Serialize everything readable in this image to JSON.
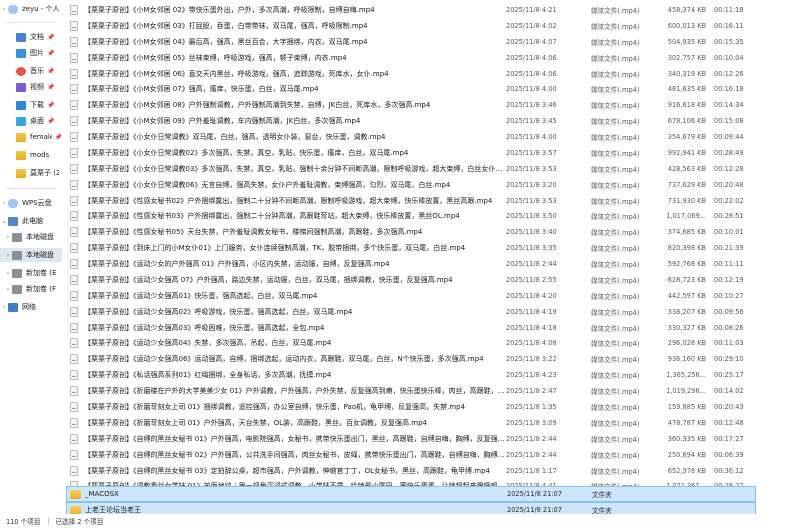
{
  "sidebar": {
    "items": [
      {
        "label": "zeyu - 个人",
        "icon": "cloud-icon",
        "chevron": "›",
        "pin": ""
      },
      {
        "label": "文档",
        "icon": "document-icon",
        "chevron": "",
        "pin": "📌"
      },
      {
        "label": "图片",
        "icon": "picture-icon",
        "chevron": "",
        "pin": "📌"
      },
      {
        "label": "音乐",
        "icon": "music-icon",
        "chevron": "",
        "pin": "📌"
      },
      {
        "label": "视频",
        "icon": "video-icon",
        "chevron": "",
        "pin": "📌"
      },
      {
        "label": "下载",
        "icon": "download-icon",
        "chevron": "",
        "pin": "📌"
      },
      {
        "label": "桌面",
        "icon": "desktop-icon",
        "chevron": "",
        "pin": "📌"
      },
      {
        "label": "female",
        "icon": "folder-icon",
        "chevron": "",
        "pin": "📌"
      },
      {
        "label": "mods",
        "icon": "folder-icon",
        "chevron": "",
        "pin": ""
      },
      {
        "label": "莫栗子 (20",
        "icon": "folder-icon",
        "chevron": "",
        "pin": ""
      },
      {
        "label": "WPS云盘",
        "icon": "cloud-drive-icon",
        "chevron": "›",
        "pin": ""
      },
      {
        "label": "此电脑",
        "icon": "computer-icon",
        "chevron": "⌄",
        "pin": ""
      },
      {
        "label": "本地磁盘",
        "icon": "drive-icon",
        "chevron": "›",
        "pin": ""
      },
      {
        "label": "本地磁盘",
        "icon": "drive-icon",
        "chevron": "›",
        "pin": ""
      },
      {
        "label": "新加卷 (E",
        "icon": "drive-icon",
        "chevron": "›",
        "pin": ""
      },
      {
        "label": "新加卷 (F",
        "icon": "drive-icon",
        "chevron": "›",
        "pin": ""
      },
      {
        "label": "网络",
        "icon": "network-icon",
        "chevron": "›",
        "pin": ""
      }
    ]
  },
  "files": [
    {
      "name": "【栗栗子原创】《小M女邻居 02》带快乐蛋外出，户外，多次高潮，呼吸限制，自缚自嗨.mp4",
      "date": "2025/11/8 4:21",
      "type": "媒体文件(.mp4)",
      "size": "458,374 KB",
      "duration": "00:11:18"
    },
    {
      "name": "【栗栗子原创】《小M女邻居 03》打屁股，吞蛋，白带带袜，双马尾，强高，呼吸限制.mp4",
      "date": "2025/11/8 4:02",
      "type": "媒体文件(.mp4)",
      "size": "600,013 KB",
      "duration": "00:16:11"
    },
    {
      "name": "【栗栗子原创】《小M女邻居 04》最后高，强高，黑丝百合，大字捆绑，内衣，双马尾.mp4",
      "date": "2025/11/8 4:07",
      "type": "媒体文件(.mp4)",
      "size": "504,935 KB",
      "duration": "00:15:35"
    },
    {
      "name": "【栗栗子原创】《小M女邻居 05》丝袜束缚，呼吸游戏，强高，顿子束缚，内衣.mp4",
      "date": "2025/11/8 4:06",
      "type": "媒体文件(.mp4)",
      "size": "302,757 KB",
      "duration": "00:10:04"
    },
    {
      "name": "【栗栗子原创】《小M女邻居 06》直交天内黑丝，呼吸游戏，强高，追踪游戏，死库水，女仆.mp4",
      "date": "2025/11/8 4:06",
      "type": "媒体文件(.mp4)",
      "size": "340,319 KB",
      "duration": "00:12:26"
    },
    {
      "name": "【栗栗子原创】《小M女邻居 07》强高，瘙痒，快乐蛋，白丝，双马尾.mp4",
      "date": "2025/11/8 4:00",
      "type": "媒体文件(.mp4)",
      "size": "481,635 KB",
      "duration": "00:16:18"
    },
    {
      "name": "【栗栗子原创】《小M女邻居 08》户外强制调教，户外强制高潮到失禁，自缚，JK白丝，死库水，多次强高.mp4",
      "date": "2025/11/8 3:46",
      "type": "媒体文件(.mp4)",
      "size": "916,618 KB",
      "duration": "00:14:34"
    },
    {
      "name": "【栗栗子原创】《小M女邻居 09》户外羞耻调教，车内强制高潮，JK白丝，多次强高.mp4",
      "date": "2025/11/8 3:45",
      "type": "媒体文件(.mp4)",
      "size": "678,106 KB",
      "duration": "00:15:08"
    },
    {
      "name": "【栗栗子原创】《小女仆日常调教》双马尾，白丝，强高，透明女仆装，窗台，快乐蛋，调教.mp4",
      "date": "2025/11/8 4:00",
      "type": "媒体文件(.mp4)",
      "size": "354,679 KB",
      "duration": "00:09:44"
    },
    {
      "name": "【栗栗子原创】《小女仆日常调教02》多次强高，失禁，真空，乳贴，快乐蛋，瘙痒，白丝，双马尾.mp4",
      "date": "2025/11/8 3:57",
      "type": "媒体文件(.mp4)",
      "size": "992,941 KB",
      "duration": "00:28:49"
    },
    {
      "name": "【栗栗子原创】《小女仆日常调教03》多次强高，失禁，真空，乳贴，强制十余分钟不间断高潮，限制呼吸游戏，超大束缚，白丝女仆，快乐棒快乐...",
      "date": "2025/11/8 3:53",
      "type": "媒体文件(.mp4)",
      "size": "428,563 KB",
      "duration": "00:12:28"
    },
    {
      "name": "【栗栗子原创】《小女仆日常调教06》无言自缚，强高失禁，女仆户外羞耻调教，束缚强高，匀烈，双马尾，白丝.mp4",
      "date": "2025/11/8 3:20",
      "type": "媒体文件(.mp4)",
      "size": "737,629 KB",
      "duration": "00:20:48"
    },
    {
      "name": "【栗栗子原创】《性感女秘书02》户外捆绑露出，强制二十分钟不间断高潮，限制呼吸游戏，超大束缚，快乐棒放置，黑丝高跟.mp4",
      "date": "2025/11/8 3:53",
      "type": "媒体文件(.mp4)",
      "size": "731,930 KB",
      "duration": "00:22:02"
    },
    {
      "name": "【栗栗子原创】《性感女秘书03》户外捆绑露出，强制二十分钟高潮，高跟鞋苛站，超大束缚，快乐棒放置，黑丝OL.mp4",
      "date": "2025/11/8 3:50",
      "type": "媒体文件(.mp4)",
      "size": "1,017,069...",
      "duration": "00:28:51"
    },
    {
      "name": "【栗栗子原创】《性感女秘书05》天台失禁，户外羞耻调教女秘书，楼梯间强制高潮，高跟鞋，多次强高.mp4",
      "date": "2025/11/8 3:40",
      "type": "媒体文件(.mp4)",
      "size": "374,685 KB",
      "duration": "00:10:01"
    },
    {
      "name": "【栗栗子原创】《到床上门的小M女仆01》上门服务，女仆连续强制高潮，TK，胶带捆绑，多个快乐蛋，双马尾，白丝.mp4",
      "date": "2025/11/8 3:35",
      "type": "媒体文件(.mp4)",
      "size": "820,398 KB",
      "duration": "00:21:39"
    },
    {
      "name": "【栗栗子原创】《运动少女的户外强高 01》户外强高，小区内失禁，运动服，自缚，反复强高.mp4",
      "date": "2025/11/8 2:44",
      "type": "媒体文件(.mp4)",
      "size": "592,768 KB",
      "duration": "00:11:11"
    },
    {
      "name": "【栗栗子原创】《运动少女强高 07》户外强高，路边失禁，运动服，白丝，双马尾，捆绑调教，快乐蛋，反复强高.mp4",
      "date": "2025/11/8 2:55",
      "type": "媒体文件(.mp4)",
      "size": "628,723 KB",
      "duration": "00:12:19"
    },
    {
      "name": "【栗栗子原创】《运动少女强高01》快乐蛋，强高选起，白丝，双马尾.mp4",
      "date": "2025/11/8 4:20",
      "type": "媒体文件(.mp4)",
      "size": "442,597 KB",
      "duration": "00:10:27"
    },
    {
      "name": "【栗栗子原创】《运动少女强高02》呼吸游戏，快乐蛋，强高选起，白丝，双马尾.mp4",
      "date": "2025/11/8 4:19",
      "type": "媒体文件(.mp4)",
      "size": "338,207 KB",
      "duration": "00:09:56"
    },
    {
      "name": "【栗栗子原创】《运动少女强高03》呼吸困难，快乐蛋，强高选起，全包.mp4",
      "date": "2025/11/8 4:18",
      "type": "媒体文件(.mp4)",
      "size": "330,327 KB",
      "duration": "00:08:26"
    },
    {
      "name": "【栗栗子原创】《运动少女强高04》失禁，多次强高，吊起，白丝，双马尾.mp4",
      "date": "2025/11/8 4:08",
      "type": "媒体文件(.mp4)",
      "size": "296,028 KB",
      "duration": "00:11:03"
    },
    {
      "name": "【栗栗子原创】《运动少女强高06》运动强高，自缚，捆绑选起，运动内衣，高跟鞋，双马尾，白丝，N个快乐蛋，多次强高.mp4",
      "date": "2025/11/8 3:22",
      "type": "媒体文件(.mp4)",
      "size": "936,160 KB",
      "duration": "00:29:10"
    },
    {
      "name": "【栗栗子原创】《私话强高系列01》红绳捆绑，全身私话，多次高潮，抚摸.mp4",
      "date": "2025/11/8 4:23",
      "type": "媒体文件(.mp4)",
      "size": "1,365,256...",
      "duration": "00:25:17"
    },
    {
      "name": "【栗栗子原创】《折磨楼在户外的大学美美少女 01》户外调教，户外强高，户外失禁，反复强高到瘫，快乐蛋快乐棒，肉丝，高跟鞋，透视服，电...",
      "date": "2025/11/8 2:47",
      "type": "媒体文件(.mp4)",
      "size": "1,019,296...",
      "duration": "00:14:02"
    },
    {
      "name": "【栗栗子原创】《折磨苛刻女上司 01》捆绑调教，遥控强高，办公室自缚，快乐蛋，Pao机，龟甲缚，反复强高，失禁.mp4",
      "date": "2025/11/8 1:35",
      "type": "媒体文件(.mp4)",
      "size": "159,885 KB",
      "duration": "00:20:43"
    },
    {
      "name": "【栗栗子原创】《折磨苛刻女上司 01》户外强高，天台失禁，OL装，高跟鞋，黑丝，百女调教，反复强高.mp4",
      "date": "2025/11/8 3:09",
      "type": "媒体文件(.mp4)",
      "size": "478,787 KB",
      "duration": "00:12:48"
    },
    {
      "name": "【栗栗子原创】《自缚的黑丝女秘书 01》户外强高，电影院强高，女秘书，携带快乐蛋出门，黑丝，高跟鞋，自缚自嗨，胸缚，反复强高~.mp4",
      "date": "2025/11/8 2:44",
      "type": "媒体文件(.mp4)",
      "size": "360,335 KB",
      "duration": "00:17:27"
    },
    {
      "name": "【栗栗子原创】《自缚的黑丝女秘书 02》户外强高，公共洗手间强高，肉丝女秘书，皮绳，携带快乐蛋出门，高跟鞋，自缚自嗨，胸缚，反复强高...",
      "date": "2025/11/8 2:44",
      "type": "媒体文件(.mp4)",
      "size": "250,694 KB",
      "duration": "00:06:39"
    },
    {
      "name": "【栗栗子原创】《自缚的黑丝女秘书 03》定拍辞公桌，超市强高，户外调教，伸缩官丁丁，OL女秘书，黑丝，高跟鞋，龟甲缚.mp4",
      "date": "2025/11/8 1:17",
      "type": "媒体文件(.mp4)",
      "size": "652,378 KB",
      "duration": "00:36:12"
    },
    {
      "name": "【栗栗子原创】《调教看丝女学妹 01》放面地纹｜第一视角沉浸式调教，小学妹不乖，给她最小尾巴，塞快乐蛋蛋，让她超起来跟呼呢，持扎无...",
      "date": "2025/11/8 4:41",
      "type": "媒体文件(.mp4)",
      "size": "1,071,361...",
      "duration": "00:28:22"
    }
  ],
  "folders": [
    {
      "name": "_MACOSX",
      "date": "2025/11/8 21:07",
      "type": "文件夹"
    },
    {
      "name": "上老王论坛当老王",
      "date": "2025/11/8 21:07",
      "type": "文件夹"
    }
  ],
  "status": {
    "count": "110 个项目",
    "selection": "已选择 2 个项目"
  }
}
